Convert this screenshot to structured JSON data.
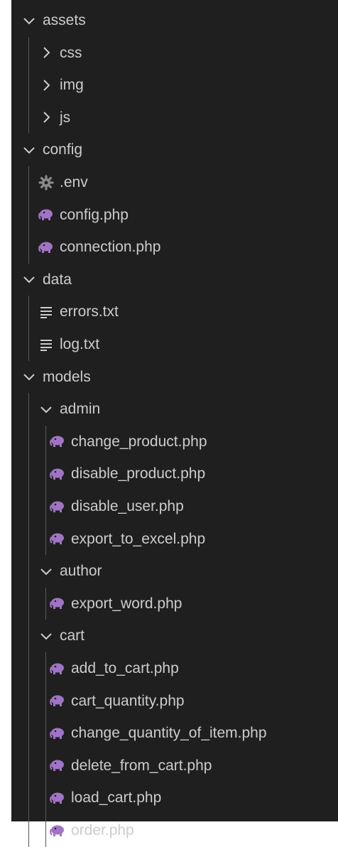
{
  "explorer": {
    "items": [
      {
        "label": "assets",
        "type": "folder",
        "expanded": true,
        "depth": 0
      },
      {
        "label": "css",
        "type": "folder",
        "expanded": false,
        "depth": 1
      },
      {
        "label": "img",
        "type": "folder",
        "expanded": false,
        "depth": 1
      },
      {
        "label": "js",
        "type": "folder",
        "expanded": false,
        "depth": 1
      },
      {
        "label": "config",
        "type": "folder",
        "expanded": true,
        "depth": 0
      },
      {
        "label": ".env",
        "type": "settings-file",
        "depth": 1
      },
      {
        "label": "config.php",
        "type": "php-file",
        "depth": 1
      },
      {
        "label": "connection.php",
        "type": "php-file",
        "depth": 1
      },
      {
        "label": "data",
        "type": "folder",
        "expanded": true,
        "depth": 0
      },
      {
        "label": "errors.txt",
        "type": "text-file",
        "depth": 1
      },
      {
        "label": "log.txt",
        "type": "text-file",
        "depth": 1
      },
      {
        "label": "models",
        "type": "folder",
        "expanded": true,
        "depth": 0
      },
      {
        "label": "admin",
        "type": "folder",
        "expanded": true,
        "depth": 1
      },
      {
        "label": "change_product.php",
        "type": "php-file",
        "depth": 2
      },
      {
        "label": "disable_product.php",
        "type": "php-file",
        "depth": 2
      },
      {
        "label": "disable_user.php",
        "type": "php-file",
        "depth": 2
      },
      {
        "label": "export_to_excel.php",
        "type": "php-file",
        "depth": 2
      },
      {
        "label": "author",
        "type": "folder",
        "expanded": true,
        "depth": 1
      },
      {
        "label": "export_word.php",
        "type": "php-file",
        "depth": 2
      },
      {
        "label": "cart",
        "type": "folder",
        "expanded": true,
        "depth": 1
      },
      {
        "label": "add_to_cart.php",
        "type": "php-file",
        "depth": 2
      },
      {
        "label": "cart_quantity.php",
        "type": "php-file",
        "depth": 2
      },
      {
        "label": "change_quantity_of_item.php",
        "type": "php-file",
        "depth": 2
      },
      {
        "label": "delete_from_cart.php",
        "type": "php-file",
        "depth": 2
      },
      {
        "label": "load_cart.php",
        "type": "php-file",
        "depth": 2
      },
      {
        "label": "order.php",
        "type": "php-file",
        "depth": 2
      }
    ]
  },
  "colors": {
    "background": "#1f1f1f",
    "text": "#cccccc",
    "php_icon": "#a074c4",
    "settings_icon": "#8a8a8a",
    "guide": "#585858"
  },
  "icons": {
    "folder_expanded": "chevron-down-icon",
    "folder_collapsed": "chevron-right-icon",
    "php-file": "php-elephant-icon",
    "settings-file": "gear-icon",
    "text-file": "text-lines-icon"
  }
}
